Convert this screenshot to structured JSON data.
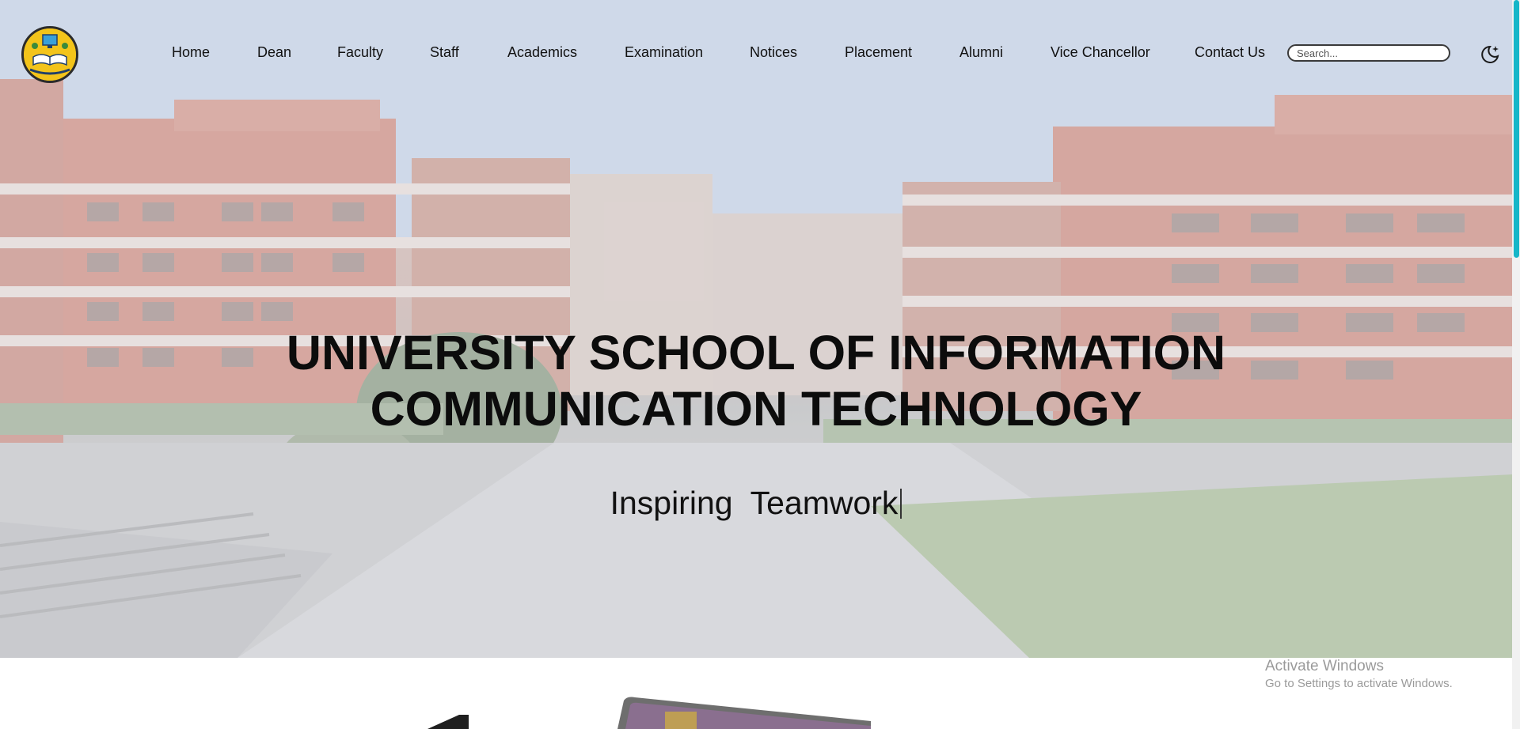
{
  "nav": {
    "items": [
      {
        "label": "Home"
      },
      {
        "label": "Dean"
      },
      {
        "label": "Faculty"
      },
      {
        "label": "Staff"
      },
      {
        "label": "Academics"
      },
      {
        "label": "Examination"
      },
      {
        "label": "Notices"
      },
      {
        "label": "Placement"
      },
      {
        "label": "Alumni"
      },
      {
        "label": "Vice Chancellor"
      },
      {
        "label": "Contact Us"
      }
    ],
    "search_placeholder": "Search...",
    "search_value": "",
    "theme_icon": "moon-icon"
  },
  "hero": {
    "title_line1": "UNIVERSITY SCHOOL OF INFORMATION",
    "title_line2": "COMMUNICATION TECHNOLOGY",
    "tagline": "Inspiring  Teamwork"
  },
  "watermark": {
    "title": "Activate Windows",
    "subtitle": "Go to Settings to activate Windows."
  },
  "colors": {
    "logo_yellow": "#f3c41a",
    "scroll_accent": "#16b6c8",
    "brick": "#c87f72"
  }
}
